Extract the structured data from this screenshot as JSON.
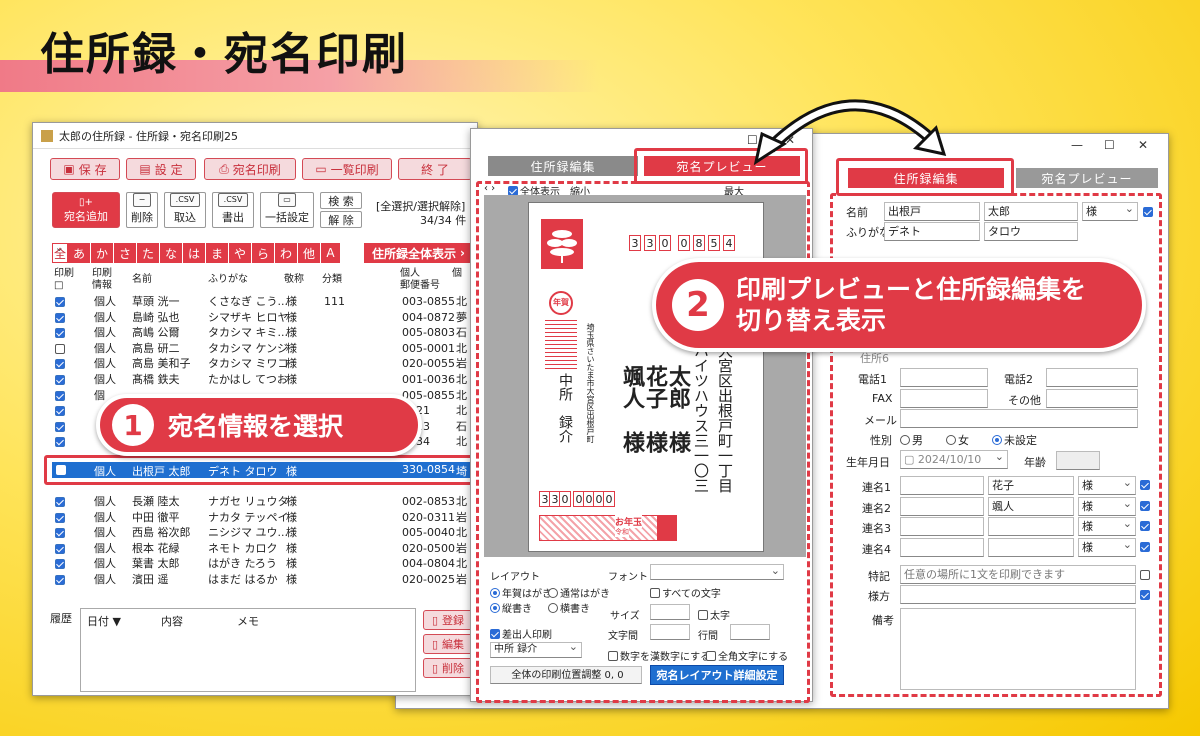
{
  "banner": {
    "title": "住所録・宛名印刷"
  },
  "win1": {
    "title": "太郎の住所録 - 住所録・宛名印刷25",
    "toolbar": [
      "保 存",
      "設 定",
      "宛名印刷",
      "一覧印刷",
      "終 了"
    ],
    "actions": {
      "add": "宛名追加",
      "delete": "削除",
      "import": "取込",
      "export": "書出",
      "bulk": "一括設定",
      "search": "検 索",
      "release": "解 除",
      "select_all": "[全選択/選択解除]",
      "count": "34/34 件",
      "csv": ".CSV"
    },
    "kana_tabs": [
      "全",
      "あ",
      "か",
      "さ",
      "た",
      "な",
      "は",
      "ま",
      "や",
      "ら",
      "わ",
      "他",
      "A"
    ],
    "show_all": "住所録全体表示",
    "headers": {
      "print": "印刷",
      "print_box": "□",
      "info": "印刷\n情報",
      "name": "名前",
      "furigana": "ふりがな",
      "title": "敬称",
      "category": "分類",
      "postal": "個人\n郵便番号",
      "extra": "個"
    },
    "rows": [
      {
        "checked": true,
        "info": "個人",
        "name": "草頭 洸一",
        "furi": "くさなぎ こう...",
        "title": "様",
        "cat": "111",
        "zip": "003-0855",
        "x": "北"
      },
      {
        "checked": true,
        "info": "個人",
        "name": "島崎 弘也",
        "furi": "シマザキ ヒロヤ",
        "title": "様",
        "cat": "",
        "zip": "004-0872",
        "x": "夢"
      },
      {
        "checked": true,
        "info": "個人",
        "name": "高嶋 公爾",
        "furi": "タカシマ キミ...",
        "title": "様",
        "cat": "",
        "zip": "005-0803",
        "x": "石"
      },
      {
        "checked": false,
        "info": "個人",
        "name": "高島 研二",
        "furi": "タカシマ ケンジ",
        "title": "様",
        "cat": "",
        "zip": "005-0001",
        "x": "北"
      },
      {
        "checked": true,
        "info": "個人",
        "name": "高島 美和子",
        "furi": "タカシマ ミワコ",
        "title": "様",
        "cat": "",
        "zip": "020-0055",
        "x": "岩"
      },
      {
        "checked": true,
        "info": "個人",
        "name": "髙橋 鉄夫",
        "furi": "たかはし てつお",
        "title": "様",
        "cat": "",
        "zip": "001-0036",
        "x": "北"
      },
      {
        "checked": true,
        "info": "個",
        "name": "",
        "furi": "",
        "title": "",
        "cat": "",
        "zip": "005-0855",
        "x": "北"
      },
      {
        "checked": true,
        "info": "",
        "name": "",
        "furi": "",
        "title": "",
        "cat": "",
        "zip": "0021",
        "x": "北"
      },
      {
        "checked": true,
        "info": "",
        "name": "",
        "furi": "",
        "title": "",
        "cat": "",
        "zip": "0823",
        "x": "石"
      },
      {
        "checked": true,
        "info": "",
        "name": "",
        "furi": "",
        "title": "",
        "cat": "",
        "zip": "0834",
        "x": "北"
      }
    ],
    "selected_row": {
      "info": "個人",
      "name": "出根戸 太郎",
      "furi": "デネト タロウ",
      "title": "様",
      "zip": "330-0854",
      "x": "埼"
    },
    "rows2": [
      {
        "checked": true,
        "info": "個人",
        "name": "長瀬 陸太",
        "furi": "ナガセ リュウタ",
        "title": "様",
        "zip": "002-0853",
        "x": "北"
      },
      {
        "checked": true,
        "info": "個人",
        "name": "中田 徹平",
        "furi": "ナカタ テッペイ",
        "title": "様",
        "zip": "020-0311",
        "x": "岩"
      },
      {
        "checked": true,
        "info": "個人",
        "name": "西島 裕次郎",
        "furi": "ニシジマ ユウ...",
        "title": "様",
        "zip": "005-0040",
        "x": "北"
      },
      {
        "checked": true,
        "info": "個人",
        "name": "根本 花緑",
        "furi": "ネモト カロク",
        "title": "様",
        "zip": "020-0500",
        "x": "岩"
      },
      {
        "checked": true,
        "info": "個人",
        "name": "葉書 太郎",
        "furi": "はがき たろう",
        "title": "様",
        "zip": "004-0804",
        "x": "北"
      },
      {
        "checked": true,
        "info": "個人",
        "name": "濱田 遥",
        "furi": "はまだ はるか",
        "title": "様",
        "zip": "020-0025",
        "x": "岩"
      }
    ],
    "history": {
      "label": "履歴",
      "cols": [
        "日付 ▼",
        "内容",
        "メモ"
      ],
      "buttons": [
        "登録",
        "編集",
        "削除"
      ]
    }
  },
  "preview": {
    "tabs": [
      "住所録編集",
      "宛名プレビュー"
    ],
    "toolbar": "全体表示　縮小",
    "right_label": "最大",
    "postal": [
      "3",
      "3",
      "0",
      "0",
      "8",
      "5",
      "4"
    ],
    "address": "大宮区出根戸町一丁目",
    "address2": "ハイツハウス三一〇三",
    "sender_addr": "埼玉県さいたま市大宮区出根戸町",
    "names": [
      "太郎",
      "花子",
      "颯人"
    ],
    "sama": [
      "様",
      "様",
      "様"
    ],
    "sender": "中所　録介",
    "sender_postal": [
      "3",
      "3",
      "0",
      "0",
      "0",
      "0",
      "0"
    ],
    "stamp": "年賀",
    "lottery": "お年玉",
    "lottery_year": "令和",
    "controls": {
      "layout": "レイアウト",
      "font": "フォント",
      "r1": "年賀はがき",
      "r2": "通常はがき",
      "r3": "縦書き",
      "r4": "横書き",
      "all_chars": "すべての文字",
      "size": "サイズ",
      "big": "太字",
      "char_space": "文字間",
      "line_space": "行間",
      "sender_print": "差出人印刷",
      "sender_name": "中所 録介",
      "kanji_num": "数字を漢数字にする",
      "fullwidth": "全角文字にする",
      "adjust": "全体の印刷位置調整 0, 0",
      "detail": "宛名レイアウト詳細設定"
    }
  },
  "edit": {
    "tabs": [
      "住所録編集",
      "宛名プレビュー"
    ],
    "name_label": "名前",
    "last": "出根戸",
    "first": "太郎",
    "title": "様",
    "furi_label": "ふりがな",
    "furi_last": "デネト",
    "furi_first": "タロウ",
    "partial_label": "住所6",
    "tel1": "電話1",
    "tel2": "電話2",
    "fax": "FAX",
    "other": "その他",
    "mail": "メール",
    "gender_label": "性別",
    "male": "男",
    "female": "女",
    "unset": "未設定",
    "birth_label": "生年月日",
    "birth": "2024/10/10",
    "age_label": "年齢",
    "rel_labels": [
      "連名1",
      "連名2",
      "連名3",
      "連名4"
    ],
    "rel_values": [
      "花子",
      "颯人",
      "",
      ""
    ],
    "rel_titles": [
      "様",
      "様",
      "様",
      "様"
    ],
    "note_label": "特記",
    "note_placeholder": "任意の場所に1文を印刷できます",
    "honor_label": "様方",
    "memo_label": "備考"
  },
  "callouts": {
    "c1_num": "1",
    "c1": "宛名情報を選択",
    "c2_num": "2",
    "c2a": "印刷プレビューと住所録編集を",
    "c2b": "切り替え表示"
  },
  "colors": {
    "accent": "#e03a46",
    "select": "#2a6bd6"
  }
}
